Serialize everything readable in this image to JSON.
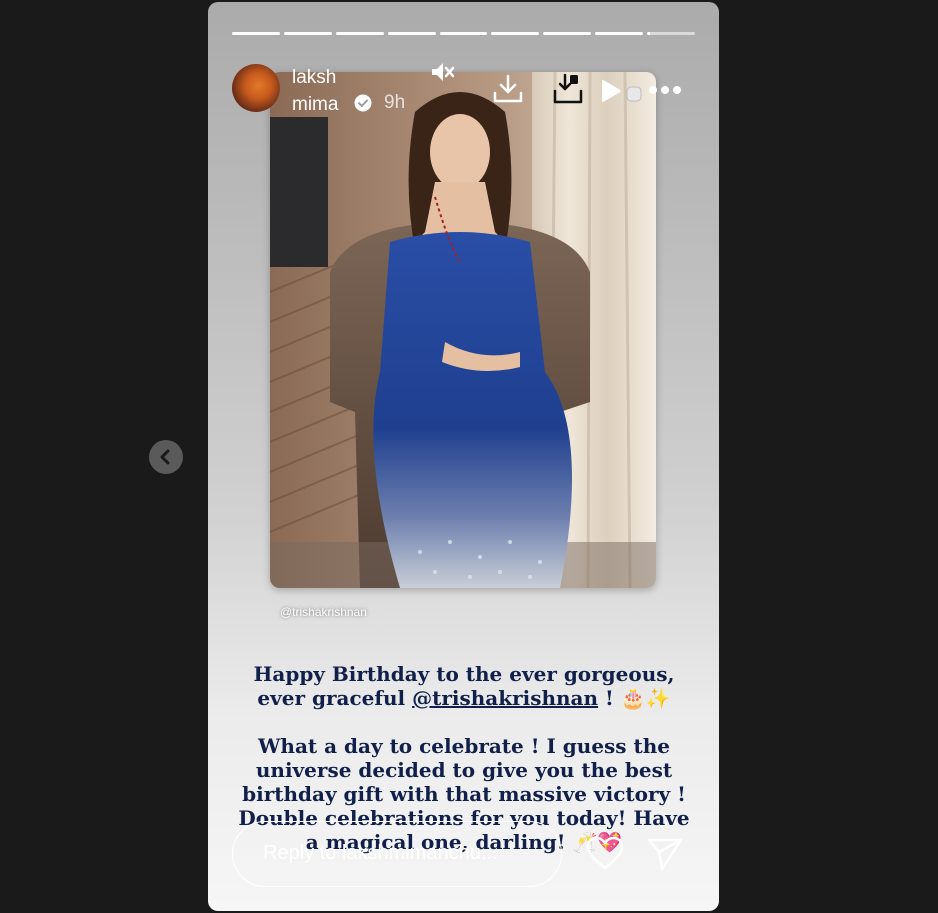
{
  "story": {
    "progress": [
      1,
      1,
      1,
      1,
      1,
      1,
      1,
      1,
      0.05
    ],
    "username": "laksh mima",
    "time": "9h",
    "photo_tag": "@trishakrishnan",
    "caption": {
      "line1_pre": "Happy Birthday to the ever gorgeous, ever graceful ",
      "mention": "@trishakrishnan",
      "line1_post": " ! 🎂✨",
      "para2": "What a day to celebrate ! I guess the universe decided to give you the best birthday gift with that massive victory ! Double celebrations for you today! Have a magical one, darling! 🥂💖"
    },
    "reply_placeholder": "Reply to lakshmimanchu..."
  },
  "icons": {
    "mute": "speaker-muted-icon",
    "download": "download-icon",
    "save": "save-to-device-icon",
    "play": "play-icon",
    "sticker": "sticker-icon",
    "more": "more-options-icon",
    "like": "heart-icon",
    "share": "send-icon",
    "prev": "chevron-left-icon"
  }
}
